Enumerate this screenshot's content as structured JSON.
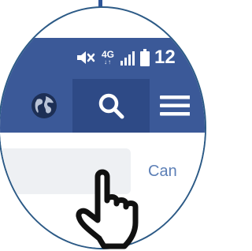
{
  "status_bar": {
    "network_label": "4G",
    "network_arrows": "↓↑",
    "clock": "12"
  },
  "nav": {
    "tabs": [
      "globe-icon",
      "search-icon",
      "menu-icon"
    ],
    "active_tab": "search"
  },
  "search": {
    "cancel_label": "Can"
  },
  "colors": {
    "brand_blue": "#3b5998",
    "active_tab_blue": "#2e4a86",
    "link_blue": "#5c7fb6",
    "search_field_gray": "#eef0f3",
    "lens_border": "#2c5a86"
  },
  "overlay": {
    "pointer_icon": "tap-hand-icon"
  }
}
